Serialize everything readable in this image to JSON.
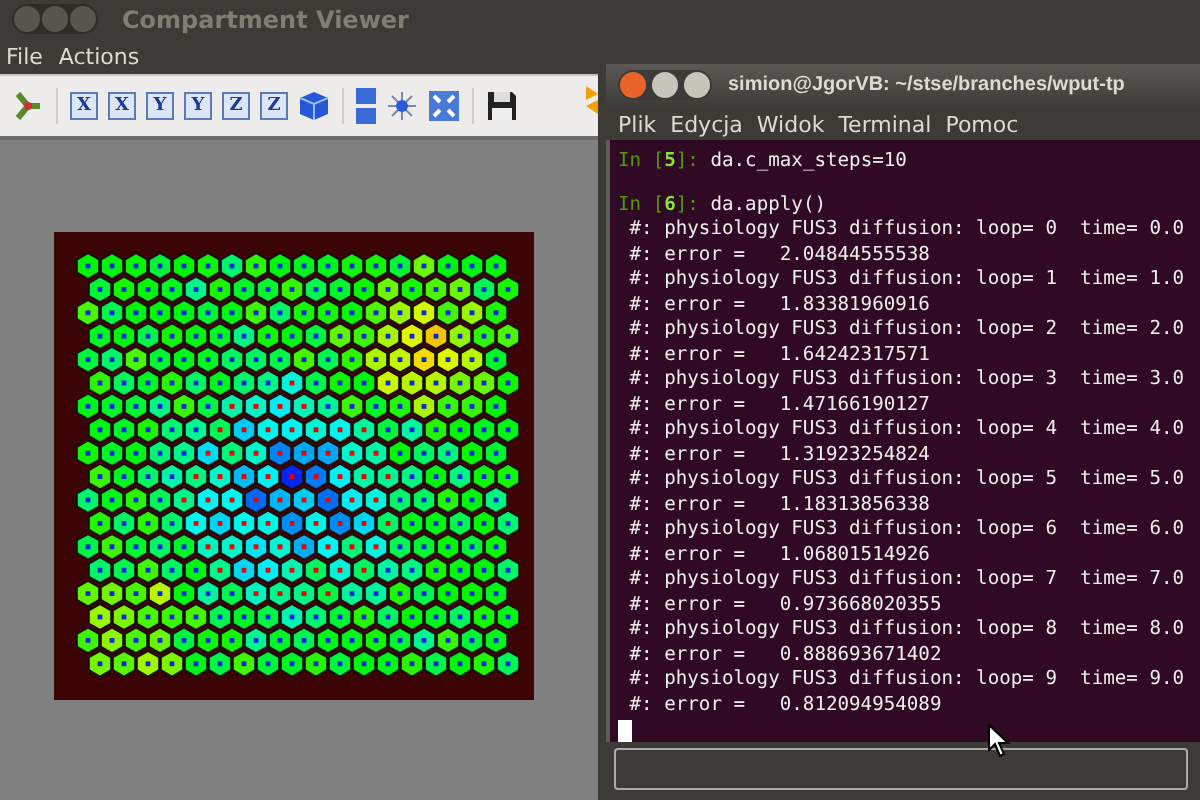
{
  "viewer": {
    "title": "Compartment Viewer",
    "active": false,
    "menu": [
      "File",
      "Actions"
    ],
    "toolbar": [
      {
        "kind": "tripod"
      },
      {
        "kind": "separator"
      },
      {
        "kind": "axis",
        "label": "X"
      },
      {
        "kind": "axis",
        "label": "X"
      },
      {
        "kind": "axis",
        "label": "Y"
      },
      {
        "kind": "axis",
        "label": "Y"
      },
      {
        "kind": "axis",
        "label": "Z"
      },
      {
        "kind": "axis",
        "label": "Z"
      },
      {
        "kind": "cube"
      },
      {
        "kind": "separator"
      },
      {
        "kind": "bar"
      },
      {
        "kind": "star"
      },
      {
        "kind": "fit"
      },
      {
        "kind": "separator"
      },
      {
        "kind": "floppy"
      }
    ]
  },
  "terminal": {
    "title": "simion@JgorVB: ~/stse/branches/wput-tp",
    "active": true,
    "menu": [
      "Plik",
      "Edycja",
      "Widok",
      "Terminal",
      "Pomoc"
    ],
    "cursor": true,
    "lines": [
      {
        "kind": "input",
        "prompt": "In [",
        "number": "5",
        "prompt_end": "]:",
        "code": "da.c_max_steps=10"
      },
      {
        "kind": "blank"
      },
      {
        "kind": "input",
        "prompt": "In [",
        "number": "6",
        "prompt_end": "]:",
        "code": "da.apply()"
      },
      {
        "kind": "output",
        "text": " #: physiology FUS3 diffusion: loop= 0  time= 0.0"
      },
      {
        "kind": "output",
        "text": " #: error =   2.04844555538"
      },
      {
        "kind": "output",
        "text": " #: physiology FUS3 diffusion: loop= 1  time= 1.0"
      },
      {
        "kind": "output",
        "text": " #: error =   1.83381960916"
      },
      {
        "kind": "output",
        "text": " #: physiology FUS3 diffusion: loop= 2  time= 2.0"
      },
      {
        "kind": "output",
        "text": " #: error =   1.64242317571"
      },
      {
        "kind": "output",
        "text": " #: physiology FUS3 diffusion: loop= 3  time= 3.0"
      },
      {
        "kind": "output",
        "text": " #: error =   1.47166190127"
      },
      {
        "kind": "output",
        "text": " #: physiology FUS3 diffusion: loop= 4  time= 4.0"
      },
      {
        "kind": "output",
        "text": " #: error =   1.31923254824"
      },
      {
        "kind": "output",
        "text": " #: physiology FUS3 diffusion: loop= 5  time= 5.0"
      },
      {
        "kind": "output",
        "text": " #: error =   1.18313856338"
      },
      {
        "kind": "output",
        "text": " #: physiology FUS3 diffusion: loop= 6  time= 6.0"
      },
      {
        "kind": "output",
        "text": " #: error =   1.06801514926"
      },
      {
        "kind": "output",
        "text": " #: physiology FUS3 diffusion: loop= 7  time= 7.0"
      },
      {
        "kind": "output",
        "text": " #: error =   0.973668020355"
      },
      {
        "kind": "output",
        "text": " #: physiology FUS3 diffusion: loop= 8  time= 8.0"
      },
      {
        "kind": "output",
        "text": " #: error =   0.888693671402"
      },
      {
        "kind": "output",
        "text": " #: physiology FUS3 diffusion: loop= 9  time= 9.0"
      },
      {
        "kind": "output",
        "text": " #: error =   0.812094954089"
      }
    ]
  }
}
